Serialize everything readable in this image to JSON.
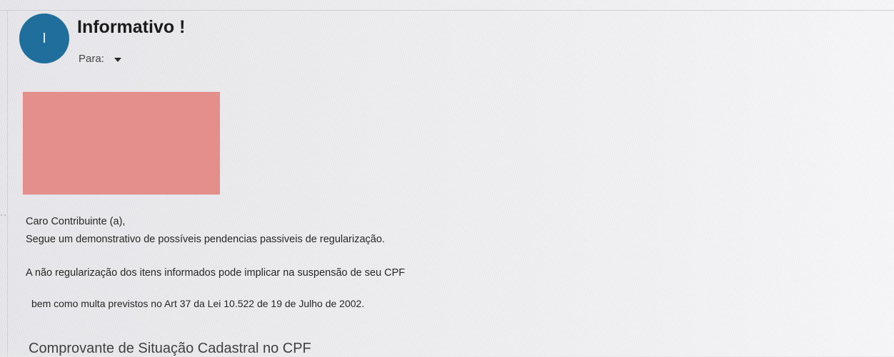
{
  "email": {
    "avatar_letter": "I",
    "subject": "Informativo !",
    "to_label": "Para:"
  },
  "body": {
    "greeting": "Caro Contribuinte (a),",
    "line1": "Segue um demonstrativo de possíveis pendencias passiveis de regularização.",
    "line2": "A não regularização dos itens informados pode implicar na suspensão de seu CPF",
    "line3": "bem como multa previstos no Art 37 da Lei 10.522 de 19 de Julho de 2002.",
    "attachment_title": "Comprovante de Situação Cadastral no CPF"
  },
  "colors": {
    "avatar": "#1f6e9c",
    "redacted_banner": "#e58f8c"
  },
  "icons": {
    "recipient_toggle": "caret-down-icon"
  }
}
